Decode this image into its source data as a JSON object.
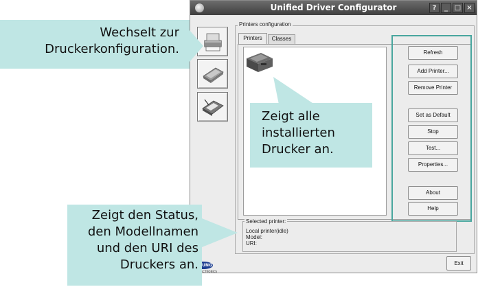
{
  "window": {
    "title": "Unified Driver Configurator",
    "controls": [
      "?",
      "_",
      "□",
      "×"
    ]
  },
  "modules": [
    {
      "icon": "printer-module-icon"
    },
    {
      "icon": "scanner-module-icon"
    },
    {
      "icon": "port-module-icon"
    }
  ],
  "group_title": "Printers configuration",
  "tabs": [
    "Printers",
    "Classes"
  ],
  "actions": [
    "Refresh",
    "Add Printer...",
    "Remove Printer",
    "Set as Default",
    "Stop",
    "Test...",
    "Properties...",
    "About",
    "Help"
  ],
  "selected": {
    "title": "Selected printer:",
    "local": "Local printer(idle)",
    "model": "Model:",
    "uri": "URI:"
  },
  "exit_label": "Exit",
  "logo": {
    "text": "SUNG",
    "sub": "ELECTRONICS"
  },
  "callouts": {
    "top_left": [
      "Wechselt zur",
      "Druckerkonfiguration."
    ],
    "middle": [
      "Zeigt alle",
      "installierten",
      "Drucker an."
    ],
    "bottom_left": [
      "Zeigt den Status,",
      "den Modellnamen",
      "und den URI des",
      "Druckers an."
    ]
  },
  "colors": {
    "callout": "#bfe6e4",
    "highlight_border": "#48a69e",
    "titlebar": "#4a4a4a"
  }
}
